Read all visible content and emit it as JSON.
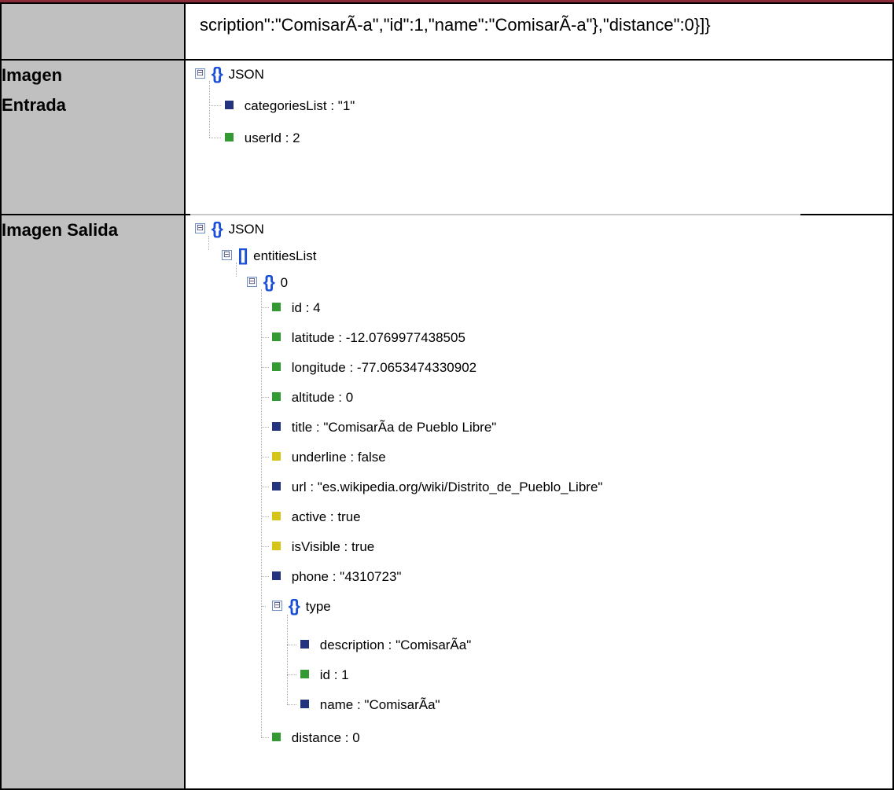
{
  "row1": {
    "json_text": "scription\":\"ComisarÃ-a\",\"id\":1,\"name\":\"ComisarÃ-a\"},\"distance\":0}]}"
  },
  "row2": {
    "label_line1": "Imagen",
    "label_line2": "Entrada",
    "tree": {
      "root": "JSON",
      "items": [
        {
          "text": "categoriesList : \"1\"",
          "color": "#24337d"
        },
        {
          "text": "userId : 2",
          "color": "#339933"
        }
      ]
    }
  },
  "row3": {
    "label": "Imagen Salida",
    "tree": {
      "root": "JSON",
      "entities_list": "entitiesList",
      "entity_index": "0",
      "fields": [
        {
          "text": "id : 4",
          "color": "#339933"
        },
        {
          "text": "latitude : -12.0769977438505",
          "color": "#339933"
        },
        {
          "text": "longitude : -77.0653474330902",
          "color": "#339933"
        },
        {
          "text": "altitude : 0",
          "color": "#339933"
        },
        {
          "text": "title : \"ComisarÃa de Pueblo Libre\"",
          "color": "#24337d"
        },
        {
          "text": "underline : false",
          "color": "#d6c419"
        },
        {
          "text": "url : \"es.wikipedia.org/wiki/Distrito_de_Pueblo_Libre\"",
          "color": "#24337d"
        },
        {
          "text": "active : true",
          "color": "#d6c419"
        },
        {
          "text": "isVisible : true",
          "color": "#d6c419"
        },
        {
          "text": "phone : \"4310723\"",
          "color": "#24337d"
        }
      ],
      "type_label": "type",
      "type_fields": [
        {
          "text": "description : \"ComisarÃa\"",
          "color": "#24337d"
        },
        {
          "text": "id : 1",
          "color": "#339933"
        },
        {
          "text": "name : \"ComisarÃa\"",
          "color": "#24337d"
        }
      ],
      "distance": {
        "text": "distance : 0",
        "color": "#339933"
      }
    }
  },
  "icons": {
    "toggle_collapse": "⊟",
    "object_brace": "{}",
    "array_bracket": "[]"
  }
}
